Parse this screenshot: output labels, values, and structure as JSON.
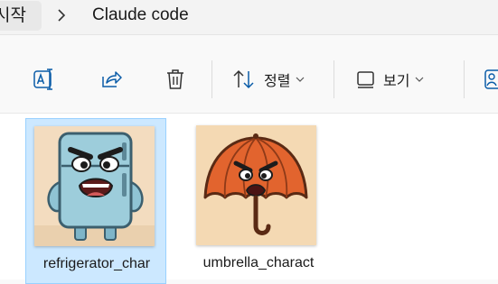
{
  "breadcrumb": {
    "root_label": "시작",
    "separator_icon": "chevron-right-icon",
    "current_label": "Claude code"
  },
  "toolbar": {
    "rename_icon": "rename-icon",
    "share_icon": "share-icon",
    "delete_icon": "trash-icon",
    "sort": {
      "icon": "sort-arrows-icon",
      "label": "정렬",
      "chevron": "chevron-down-icon"
    },
    "view": {
      "icon": "view-square-icon",
      "label": "보기",
      "chevron": "chevron-down-icon"
    },
    "details_icon": "details-pane-icon"
  },
  "files": [
    {
      "name": "refrigerator_char",
      "thumbnail": "angry-refrigerator-character",
      "selected": true
    },
    {
      "name": "umbrella_charact",
      "thumbnail": "angry-umbrella-character",
      "selected": false
    }
  ],
  "colors": {
    "selection_bg": "#cce8ff",
    "selection_border": "#99d1ff",
    "accent": "#005fb8",
    "toolbar_bg": "#f9f9f9"
  }
}
